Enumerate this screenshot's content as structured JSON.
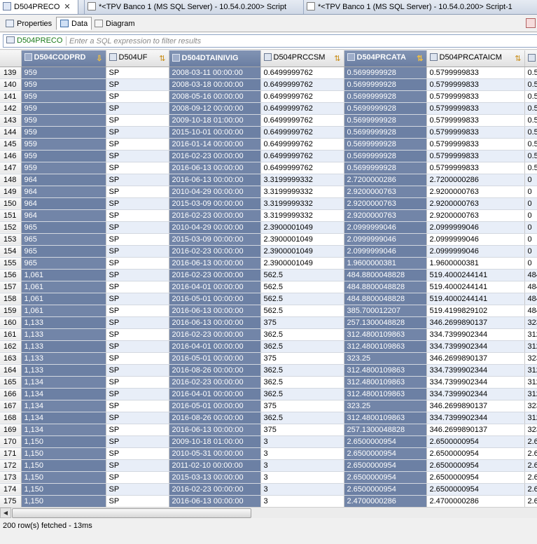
{
  "editor_tabs": [
    {
      "label": "D504PRECO",
      "active": true
    },
    {
      "label": "*<TPV Banco 1 (MS SQL Server) - 10.54.0.200> Script",
      "active": false
    },
    {
      "label": "*<TPV Banco 1 (MS SQL Server) - 10.54.0.200> Script-1",
      "active": false
    }
  ],
  "sub_tabs": [
    "Properties",
    "Data",
    "Diagram"
  ],
  "filter": {
    "source": "D504PRECO",
    "placeholder": "Enter a SQL expression to filter results"
  },
  "columns": [
    "D504CODPRD",
    "D504UF",
    "D504DTAINIVIG",
    "D504PRCCSM",
    "D504PRCATA",
    "D504PRCATAICM",
    ""
  ],
  "rows": [
    [
      "139",
      "959",
      "SP",
      "2008-03-11 00:00:00",
      "0.6499999762",
      "0.5699999928",
      "0.5799999833",
      "0.5("
    ],
    [
      "140",
      "959",
      "SP",
      "2008-03-18 00:00:00",
      "0.6499999762",
      "0.5699999928",
      "0.5799999833",
      "0.5("
    ],
    [
      "141",
      "959",
      "SP",
      "2008-05-16 00:00:00",
      "0.6499999762",
      "0.5699999928",
      "0.5799999833",
      "0.5("
    ],
    [
      "142",
      "959",
      "SP",
      "2008-09-12 00:00:00",
      "0.6499999762",
      "0.5699999928",
      "0.5799999833",
      "0.5("
    ],
    [
      "143",
      "959",
      "SP",
      "2009-10-18 01:00:00",
      "0.6499999762",
      "0.5699999928",
      "0.5799999833",
      "0.5("
    ],
    [
      "144",
      "959",
      "SP",
      "2015-10-01 00:00:00",
      "0.6499999762",
      "0.5699999928",
      "0.5799999833",
      "0.5("
    ],
    [
      "145",
      "959",
      "SP",
      "2016-01-14 00:00:00",
      "0.6499999762",
      "0.5699999928",
      "0.5799999833",
      "0.5("
    ],
    [
      "146",
      "959",
      "SP",
      "2016-02-23 00:00:00",
      "0.6499999762",
      "0.5699999928",
      "0.5799999833",
      "0.5("
    ],
    [
      "147",
      "959",
      "SP",
      "2016-06-13 00:00:00",
      "0.6499999762",
      "0.5699999928",
      "0.5799999833",
      "0.5("
    ],
    [
      "148",
      "964",
      "SP",
      "2016-06-13 00:00:00",
      "3.3199999332",
      "2.7200000286",
      "2.7200000286",
      "0"
    ],
    [
      "149",
      "964",
      "SP",
      "2010-04-29 00:00:00",
      "3.3199999332",
      "2.9200000763",
      "2.9200000763",
      "0"
    ],
    [
      "150",
      "964",
      "SP",
      "2015-03-09 00:00:00",
      "3.3199999332",
      "2.9200000763",
      "2.9200000763",
      "0"
    ],
    [
      "151",
      "964",
      "SP",
      "2016-02-23 00:00:00",
      "3.3199999332",
      "2.9200000763",
      "2.9200000763",
      "0"
    ],
    [
      "152",
      "965",
      "SP",
      "2010-04-29 00:00:00",
      "2.3900001049",
      "2.0999999046",
      "2.0999999046",
      "0"
    ],
    [
      "153",
      "965",
      "SP",
      "2015-03-09 00:00:00",
      "2.3900001049",
      "2.0999999046",
      "2.0999999046",
      "0"
    ],
    [
      "154",
      "965",
      "SP",
      "2016-02-23 00:00:00",
      "2.3900001049",
      "2.0999999046",
      "2.0999999046",
      "0"
    ],
    [
      "155",
      "965",
      "SP",
      "2016-06-13 00:00:00",
      "2.3900001049",
      "1.9600000381",
      "1.9600000381",
      "0"
    ],
    [
      "156",
      "1,061",
      "SP",
      "2016-02-23 00:00:00",
      "562.5",
      "484.8800048828",
      "519.4000244141",
      "484"
    ],
    [
      "157",
      "1,061",
      "SP",
      "2016-04-01 00:00:00",
      "562.5",
      "484.8800048828",
      "519.4000244141",
      "484"
    ],
    [
      "158",
      "1,061",
      "SP",
      "2016-05-01 00:00:00",
      "562.5",
      "484.8800048828",
      "519.4000244141",
      "484"
    ],
    [
      "159",
      "1,061",
      "SP",
      "2016-06-13 00:00:00",
      "562.5",
      "385.700012207",
      "519.4199829102",
      "484"
    ],
    [
      "160",
      "1,133",
      "SP",
      "2016-06-13 00:00:00",
      "375",
      "257.1300048828",
      "346.2699890137",
      "323"
    ],
    [
      "161",
      "1,133",
      "SP",
      "2016-02-23 00:00:00",
      "362.5",
      "312.4800109863",
      "334.7399902344",
      "312"
    ],
    [
      "162",
      "1,133",
      "SP",
      "2016-04-01 00:00:00",
      "362.5",
      "312.4800109863",
      "334.7399902344",
      "312"
    ],
    [
      "163",
      "1,133",
      "SP",
      "2016-05-01 00:00:00",
      "375",
      "323.25",
      "346.2699890137",
      "323"
    ],
    [
      "164",
      "1,133",
      "SP",
      "2016-08-26 00:00:00",
      "362.5",
      "312.4800109863",
      "334.7399902344",
      "312"
    ],
    [
      "165",
      "1,134",
      "SP",
      "2016-02-23 00:00:00",
      "362.5",
      "312.4800109863",
      "334.7399902344",
      "312"
    ],
    [
      "166",
      "1,134",
      "SP",
      "2016-04-01 00:00:00",
      "362.5",
      "312.4800109863",
      "334.7399902344",
      "312"
    ],
    [
      "167",
      "1,134",
      "SP",
      "2016-05-01 00:00:00",
      "375",
      "323.25",
      "346.2699890137",
      "323"
    ],
    [
      "168",
      "1,134",
      "SP",
      "2016-08-26 00:00:00",
      "362.5",
      "312.4800109863",
      "334.7399902344",
      "312"
    ],
    [
      "169",
      "1,134",
      "SP",
      "2016-06-13 00:00:00",
      "375",
      "257.1300048828",
      "346.2699890137",
      "323"
    ],
    [
      "170",
      "1,150",
      "SP",
      "2009-10-18 01:00:00",
      "3",
      "2.6500000954",
      "2.6500000954",
      "2.6"
    ],
    [
      "171",
      "1,150",
      "SP",
      "2010-05-31 00:00:00",
      "3",
      "2.6500000954",
      "2.6500000954",
      "2.6"
    ],
    [
      "172",
      "1,150",
      "SP",
      "2011-02-10 00:00:00",
      "3",
      "2.6500000954",
      "2.6500000954",
      "2.6"
    ],
    [
      "173",
      "1,150",
      "SP",
      "2015-03-13 00:00:00",
      "3",
      "2.6500000954",
      "2.6500000954",
      "2.6"
    ],
    [
      "174",
      "1,150",
      "SP",
      "2016-02-23 00:00:00",
      "3",
      "2.6500000954",
      "2.6500000954",
      "2.6"
    ],
    [
      "175",
      "1,150",
      "SP",
      "2016-06-13 00:00:00",
      "3",
      "2.4700000286",
      "2.4700000286",
      "2.6"
    ]
  ],
  "status": {
    "text": "200 row(s) fetched - 13ms"
  },
  "colors": {
    "selected_column": "#7285a8",
    "alt_row": "#e8eef8",
    "filter_source": "#1a7a1a"
  }
}
